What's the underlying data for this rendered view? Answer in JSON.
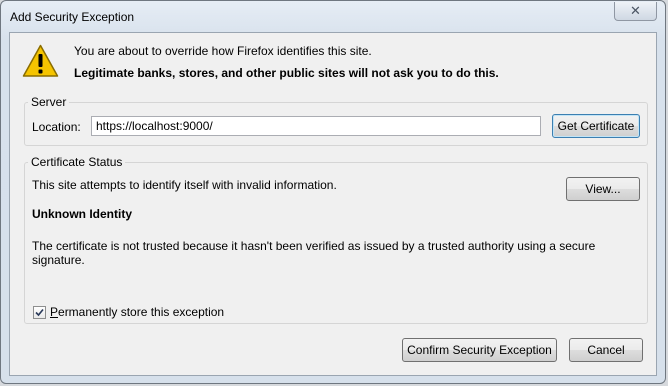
{
  "window": {
    "title": "Add Security Exception",
    "close_glyph": "✕"
  },
  "header": {
    "line1": "You are about to override how Firefox identifies this site.",
    "line2": "Legitimate banks, stores, and other public sites will not ask you to do this.",
    "icon": "warning-icon"
  },
  "server": {
    "legend": "Server",
    "location_label": "Location:",
    "location_value": "https://localhost:9000/",
    "get_certificate_label": "Get Certificate"
  },
  "certificate_status": {
    "legend": "Certificate Status",
    "status_text": "This site attempts to identify itself with invalid information.",
    "view_label": "View...",
    "identity_heading": "Unknown Identity",
    "detail_text": "The certificate is not trusted because it hasn't been verified as issued by a trusted authority using a secure signature."
  },
  "options": {
    "permanent_checked": true,
    "permanent_label_first": "P",
    "permanent_label_rest": "ermanently store this exception"
  },
  "footer": {
    "confirm_label": "Confirm Security Exception",
    "cancel_label": "Cancel"
  }
}
